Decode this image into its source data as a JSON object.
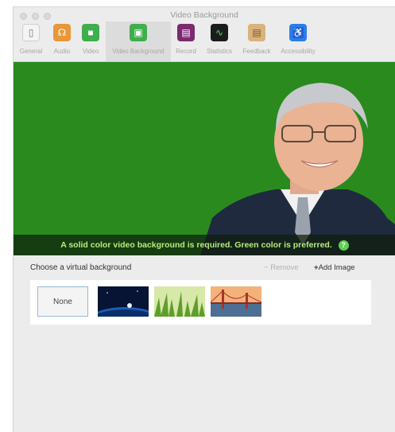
{
  "window": {
    "title": "Video Background"
  },
  "toolbar": {
    "tabs": [
      {
        "label": "General",
        "icon": "general-icon",
        "color": "#f2f2f2",
        "glyph": "▯"
      },
      {
        "label": "Audio",
        "icon": "headphones-icon",
        "color": "#e8973a",
        "glyph": "☊"
      },
      {
        "label": "Video",
        "icon": "camera-icon",
        "color": "#3fae4c",
        "glyph": "■"
      },
      {
        "label": "Video Background",
        "icon": "picture-icon",
        "color": "#3fae4c",
        "glyph": "▣"
      },
      {
        "label": "Record",
        "icon": "film-icon",
        "color": "#7b2a70",
        "glyph": "▤"
      },
      {
        "label": "Statistics",
        "icon": "pulse-icon",
        "color": "#1c1c1c",
        "glyph": "∿"
      },
      {
        "label": "Feedback",
        "icon": "clipboard-icon",
        "color": "#d9b27c",
        "glyph": "▤"
      },
      {
        "label": "Accessibility",
        "icon": "accessibility-icon",
        "color": "#2b7de9",
        "glyph": "♿"
      }
    ],
    "selected": "Video Background"
  },
  "preview": {
    "banner": "A solid color video background is required. Green color is preferred.",
    "help_icon": "?",
    "background_color": "#2a8a1e"
  },
  "backgrounds": {
    "heading": "Choose a virtual background",
    "remove_label": "Remove",
    "add_label": "Add Image",
    "none_label": "None",
    "items": [
      "None",
      "Earth from space",
      "Grass",
      "Golden Gate Bridge"
    ]
  }
}
